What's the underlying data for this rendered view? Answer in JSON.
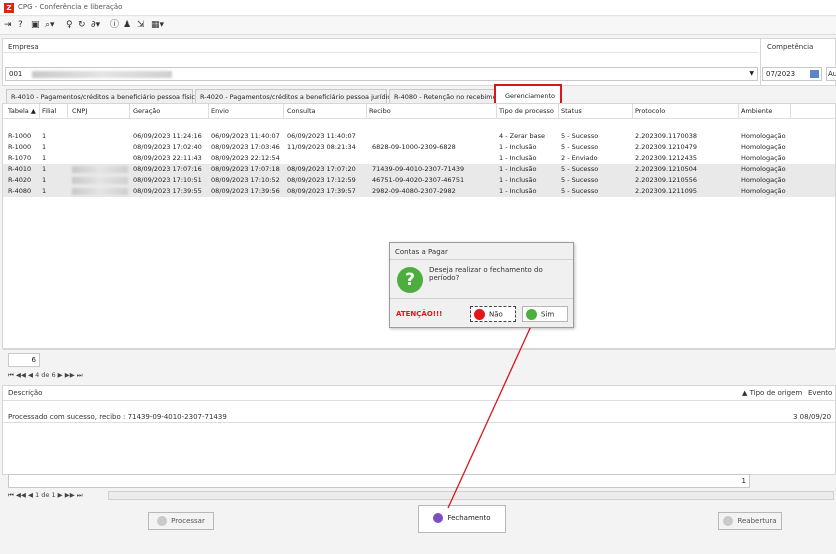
{
  "window": {
    "title": "CPG - Conferência e liberação"
  },
  "toolbar": {
    "icons": [
      "enter-icon",
      "help-icon",
      "screen-icon",
      "search-icon",
      "bulb-icon",
      "refresh-icon",
      "link-icon",
      "info-icon",
      "users-icon",
      "export-icon",
      "grid-icon"
    ]
  },
  "header": {
    "empresa_label": "Empresa",
    "empresa_value": "001",
    "competencia_label": "Competência",
    "competencia_value": "07/2023",
    "extra_value": "Au"
  },
  "tabs": [
    {
      "label": "R-4010 - Pagamentos/créditos a beneficiário pessoa física"
    },
    {
      "label": "R-4020 - Pagamentos/créditos a beneficiário pessoa jurídica"
    },
    {
      "label": "R-4080 - Retenção no recebimento"
    },
    {
      "label": "Gerenciamento"
    }
  ],
  "grid": {
    "columns": [
      "Tabela ▲",
      "Filial",
      "CNPJ",
      "Geração",
      "Envio",
      "Consulta",
      "Recibo",
      "Tipo de processo",
      "Status",
      "Protocolo",
      "Ambiente"
    ],
    "rows": [
      [
        "R-1000",
        "1",
        "",
        "06/09/2023 11:24:16",
        "06/09/2023 11:40:07",
        "06/09/2023 11:40:07",
        "",
        "4 - Zerar base",
        "5 - Sucesso",
        "2.202309.1170038",
        "Homologação"
      ],
      [
        "R-1000",
        "1",
        "",
        "08/09/2023 17:02:40",
        "08/09/2023 17:03:46",
        "11/09/2023 08:21:34",
        "6828-09-1000-2309-6828",
        "1 - Inclusão",
        "5 - Sucesso",
        "2.202309.1210479",
        "Homologação"
      ],
      [
        "R-1070",
        "1",
        "",
        "08/09/2023 22:11:43",
        "08/09/2023 22:12:54",
        "",
        "",
        "1 - Inclusão",
        "2 - Enviado",
        "2.202309.1212435",
        "Homologação"
      ],
      [
        "R-4010",
        "1",
        "",
        "08/09/2023 17:07:16",
        "08/09/2023 17:07:18",
        "08/09/2023 17:07:20",
        "71439-09-4010-2307-71439",
        "1 - Inclusão",
        "5 - Sucesso",
        "2.202309.1210504",
        "Homologação"
      ],
      [
        "R-4020",
        "1",
        "",
        "08/09/2023 17:10:51",
        "08/09/2023 17:10:52",
        "08/09/2023 17:12:59",
        "46751-09-4020-2307-46751",
        "1 - Inclusão",
        "5 - Sucesso",
        "2.202309.1210556",
        "Homologação"
      ],
      [
        "R-4080",
        "1",
        "",
        "08/09/2023 17:39:55",
        "08/09/2023 17:39:56",
        "08/09/2023 17:39:57",
        "2982-09-4080-2307-2982",
        "1 - Inclusão",
        "5 - Sucesso",
        "2.202309.1211095",
        "Homologação"
      ]
    ],
    "count": "6",
    "nav": "4 de 6"
  },
  "dialog": {
    "title": "Contas a Pagar",
    "message": "Deseja realizar o fechamento do período?",
    "warning": "ATENÇÃO!!!",
    "no_label": "Não",
    "yes_label": "Sim",
    "colors": {
      "warning": "#e3151a",
      "question": "#4caf3d"
    }
  },
  "log": {
    "col_descricao": "Descrição",
    "col_tipo_origem": "Tipo de origem",
    "col_evento": "Evento",
    "message": "Processado com sucesso, recibo : 71439-09-4010-2307-71439",
    "right_value": "3  08/09/20",
    "count": "1",
    "nav": "1 de 1"
  },
  "actions": {
    "processar": "Processar",
    "fechamento": "Fechamento",
    "reabertura": "Reabertura"
  },
  "accent": "#d9161b"
}
